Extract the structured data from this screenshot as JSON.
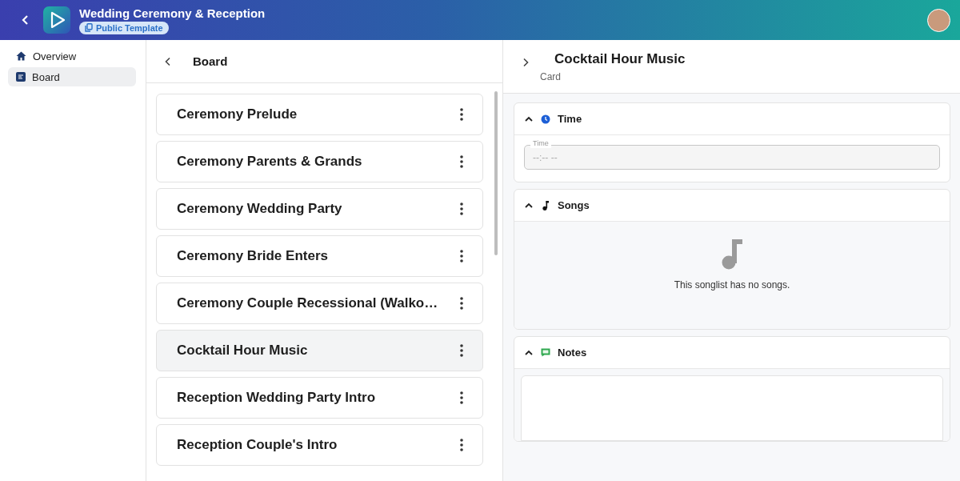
{
  "header": {
    "title": "Wedding Ceremony & Reception",
    "badge": "Public Template"
  },
  "sidebar": {
    "items": [
      {
        "label": "Overview",
        "selected": false
      },
      {
        "label": "Board",
        "selected": true
      }
    ]
  },
  "board": {
    "title": "Board",
    "cards": [
      {
        "title": "Ceremony Prelude",
        "selected": false
      },
      {
        "title": "Ceremony Parents & Grands",
        "selected": false
      },
      {
        "title": "Ceremony Wedding Party",
        "selected": false
      },
      {
        "title": "Ceremony Bride Enters",
        "selected": false
      },
      {
        "title": "Ceremony Couple Recessional (Walko…",
        "selected": false
      },
      {
        "title": "Cocktail Hour Music",
        "selected": true
      },
      {
        "title": "Reception Wedding Party Intro",
        "selected": false
      },
      {
        "title": "Reception Couple's Intro",
        "selected": false
      }
    ]
  },
  "detail": {
    "title": "Cocktail Hour Music",
    "subtitle": "Card",
    "sections": [
      {
        "kind": "time",
        "title": "Time",
        "expanded": true,
        "field": {
          "label": "Time",
          "placeholder": "--:-- --"
        }
      },
      {
        "kind": "songs",
        "title": "Songs",
        "expanded": true,
        "empty_text": "This songlist has no songs."
      },
      {
        "kind": "notes",
        "title": "Notes",
        "expanded": true
      }
    ]
  }
}
